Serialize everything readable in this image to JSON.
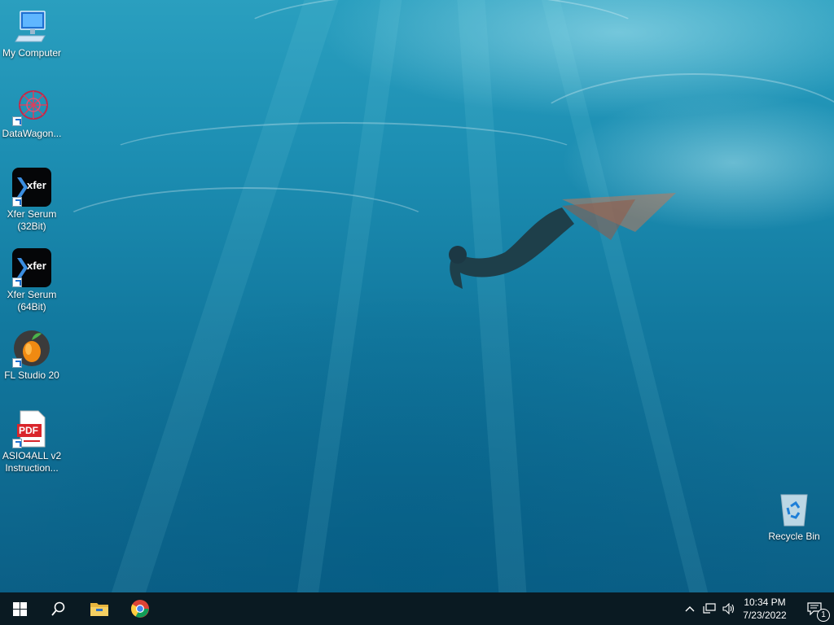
{
  "desktop": {
    "icons": [
      {
        "label": "My Computer",
        "icon": "computer-icon"
      },
      {
        "label": "DataWagon...",
        "icon": "datawagon-icon"
      },
      {
        "label": "Xfer Serum (32Bit)",
        "icon": "xfer-serum-icon",
        "badge": "xfer"
      },
      {
        "label": "Xfer Serum (64Bit)",
        "icon": "xfer-serum-icon",
        "badge": "xfer"
      },
      {
        "label": "FL Studio 20",
        "icon": "fl-studio-icon"
      },
      {
        "label": "ASIO4ALL v2 Instruction...",
        "icon": "pdf-icon",
        "badge": "PDF"
      },
      {
        "label": "Recycle Bin",
        "icon": "recycle-bin-icon"
      }
    ]
  },
  "taskbar": {
    "clock_time": "10:34 PM",
    "clock_date": "7/23/2022",
    "notification_count": "1",
    "pinned": [
      "start-icon",
      "search-icon",
      "file-explorer-icon",
      "chrome-icon"
    ],
    "tray": [
      "chevron-up-icon",
      "network-icon",
      "volume-icon",
      "action-center-icon"
    ]
  },
  "colors": {
    "taskbar_bg": "#0a1a22",
    "water_top": "#2a9fbf",
    "water_bottom": "#0b5f86"
  }
}
